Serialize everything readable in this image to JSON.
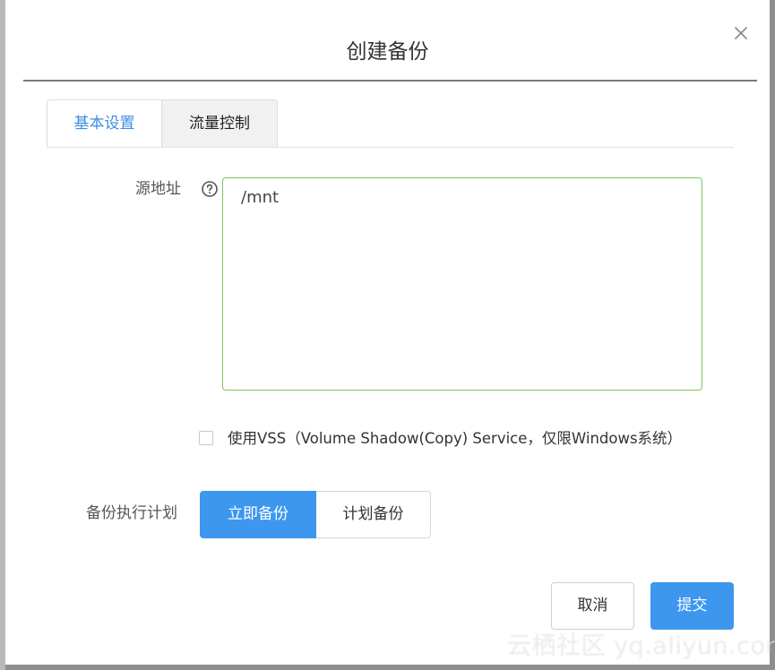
{
  "dialog": {
    "title": "创建备份",
    "close_icon": "close-icon"
  },
  "tabs": [
    {
      "label": "基本设置",
      "active": true
    },
    {
      "label": "流量控制",
      "active": false
    }
  ],
  "form": {
    "source_label": "源地址",
    "help_icon": "question-circle-icon",
    "source_value": "/mnt",
    "vss_checked": false,
    "vss_label": "使用VSS（Volume Shadow(Copy) Service，仅限Windows系统）",
    "plan_label": "备份执行计划",
    "plan_options": [
      "立即备份",
      "计划备份"
    ],
    "plan_selected": "立即备份"
  },
  "footer": {
    "cancel_label": "取消",
    "submit_label": "提交"
  },
  "watermark": "云栖社区 yq.aliyun.com",
  "colors": {
    "accent": "#3d97ef",
    "active_tab_text": "#3d8ee0",
    "input_focus_border": "#7cc75e"
  }
}
